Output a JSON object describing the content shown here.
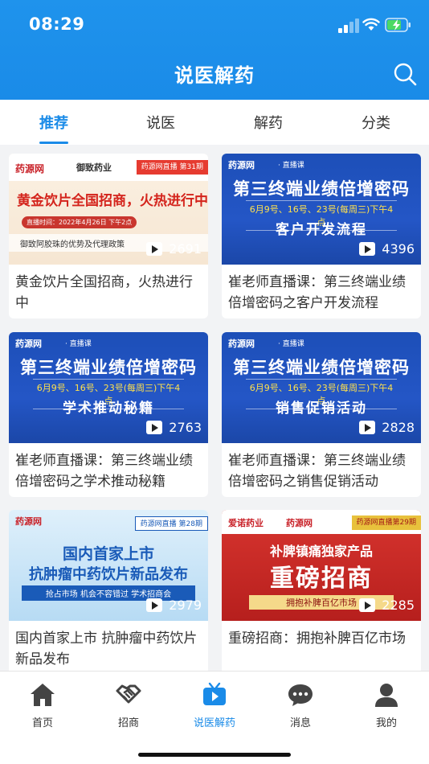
{
  "status_bar": {
    "time": "08:29"
  },
  "header": {
    "title": "说医解药"
  },
  "tabs": [
    {
      "label": "推荐",
      "active": true
    },
    {
      "label": "说医",
      "active": false
    },
    {
      "label": "解药",
      "active": false
    },
    {
      "label": "分类",
      "active": false
    }
  ],
  "cards": [
    {
      "title": "黄金饮片全国招商，火热进行中",
      "views": "2691",
      "thumb": {
        "logo": "药源网",
        "brand": "御致药业",
        "badge": "药源网直播 第31期",
        "headline": "黄金饮片全国招商，火热进行中",
        "date": "直播时间：2022年4月26日 下午2点",
        "strip": "御致阿胶珠的优势及代理政策"
      }
    },
    {
      "title": "崔老师直播课：第三终端业绩倍增密码之客户开发流程",
      "views": "4396",
      "thumb": {
        "logo": "药源网",
        "sub": "· 直播课",
        "line1": "第三终端业绩倍增密码",
        "line2": "6月9号、16号、23号(每周三)下午4点",
        "line3": "客户开发流程"
      }
    },
    {
      "title": "崔老师直播课：第三终端业绩倍增密码之学术推动秘籍",
      "views": "2763",
      "thumb": {
        "logo": "药源网",
        "sub": "· 直播课",
        "line1": "第三终端业绩倍增密码",
        "line2": "6月9号、16号、23号(每周三)下午4点",
        "line3": "学术推动秘籍"
      }
    },
    {
      "title": "崔老师直播课：第三终端业绩倍增密码之销售促销活动",
      "views": "2828",
      "thumb": {
        "logo": "药源网",
        "sub": "· 直播课",
        "line1": "第三终端业绩倍增密码",
        "line2": "6月9号、16号、23号(每周三)下午4点",
        "line3": "销售促销活动"
      }
    },
    {
      "title": "国内首家上市 抗肿瘤中药饮片 新品发布",
      "views": "2979",
      "thumb": {
        "logo": "药源网",
        "badge": "药源网直播 第28期",
        "h1": "国内首家上市",
        "h2": "抗肿瘤中药饮片新品发布",
        "h3": "抢占市场  机会不容错过  学术招商会"
      }
    },
    {
      "title": "重磅招商：拥抱补脾百亿市场",
      "views": "2285",
      "thumb": {
        "logo1": "爱诺药业",
        "logo2": "药源网",
        "badge": "药源网直播第29期",
        "h1": "补脾镇痛独家产品",
        "h2": "重磅招商",
        "h3": "拥抱补脾百亿市场"
      }
    }
  ],
  "bottom_nav": [
    {
      "label": "首页",
      "icon": "home-icon",
      "active": false
    },
    {
      "label": "招商",
      "icon": "handshake-icon",
      "active": false
    },
    {
      "label": "说医解药",
      "icon": "tv-play-icon",
      "active": true
    },
    {
      "label": "消息",
      "icon": "chat-icon",
      "active": false
    },
    {
      "label": "我的",
      "icon": "user-icon",
      "active": false
    }
  ],
  "colors": {
    "primary": "#1a8be8",
    "text": "#333333",
    "background": "#f2f3f5"
  }
}
